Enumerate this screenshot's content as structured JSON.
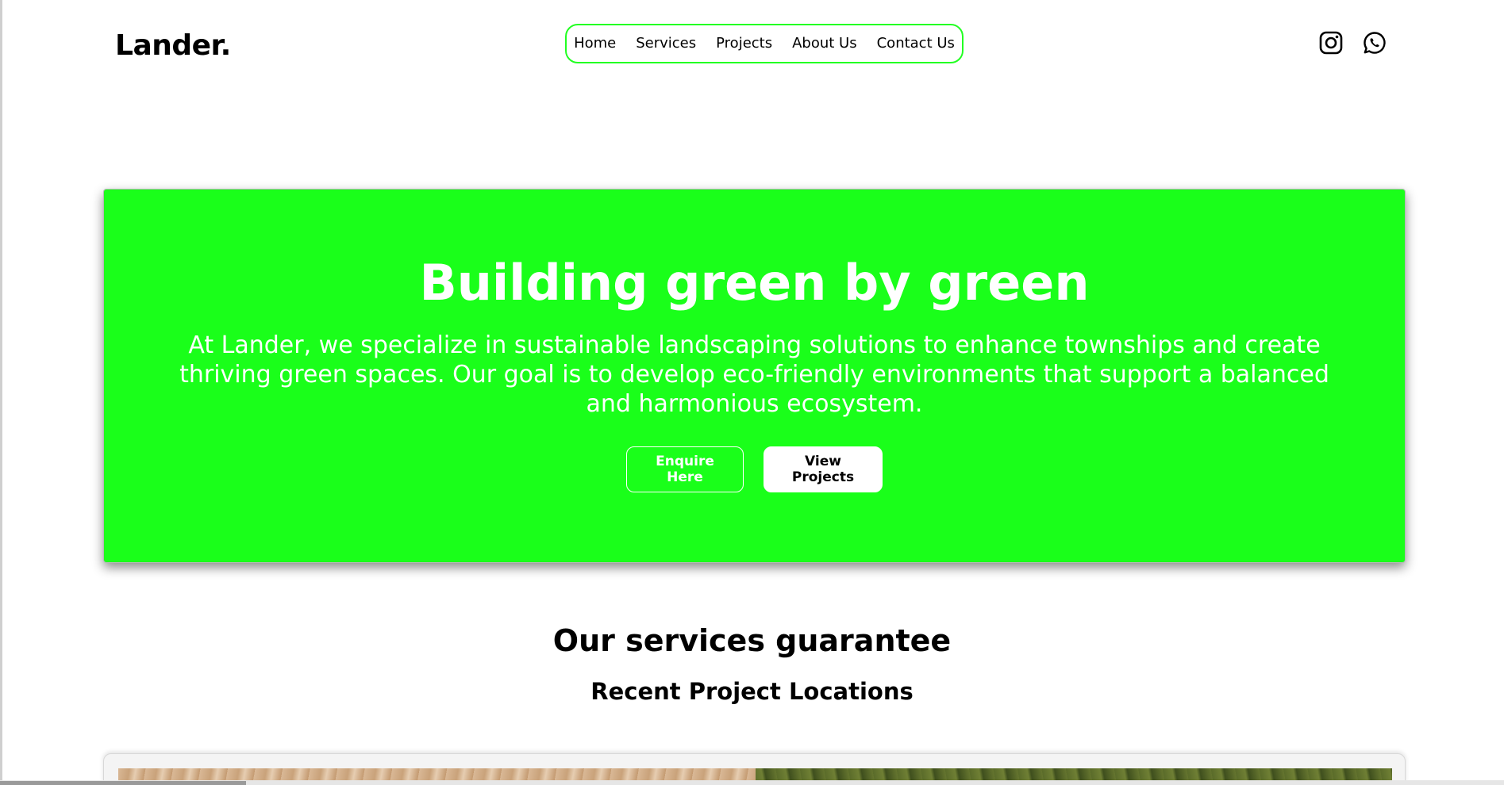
{
  "header": {
    "logo": "Lander.",
    "nav": [
      "Home",
      "Services",
      "Projects",
      "About Us",
      "Contact Us"
    ],
    "social": [
      {
        "icon": "instagram-icon"
      },
      {
        "icon": "whatsapp-icon"
      }
    ]
  },
  "hero": {
    "title": "Building green by green",
    "description": "At Lander, we specialize in sustainable landscaping solutions to enhance townships and create thriving green spaces. Our goal is to develop eco-friendly environments that support a balanced and harmonious ecosystem.",
    "primary_button": "Enquire Here",
    "secondary_button": "View Projects",
    "background_color": "#1aff1a"
  },
  "services": {
    "title": "Our services guarantee",
    "subtitle": "Recent Project Locations"
  },
  "colors": {
    "accent": "#1aff1a",
    "nav_border": "#22ff22",
    "text": "#000000",
    "background": "#ffffff"
  }
}
